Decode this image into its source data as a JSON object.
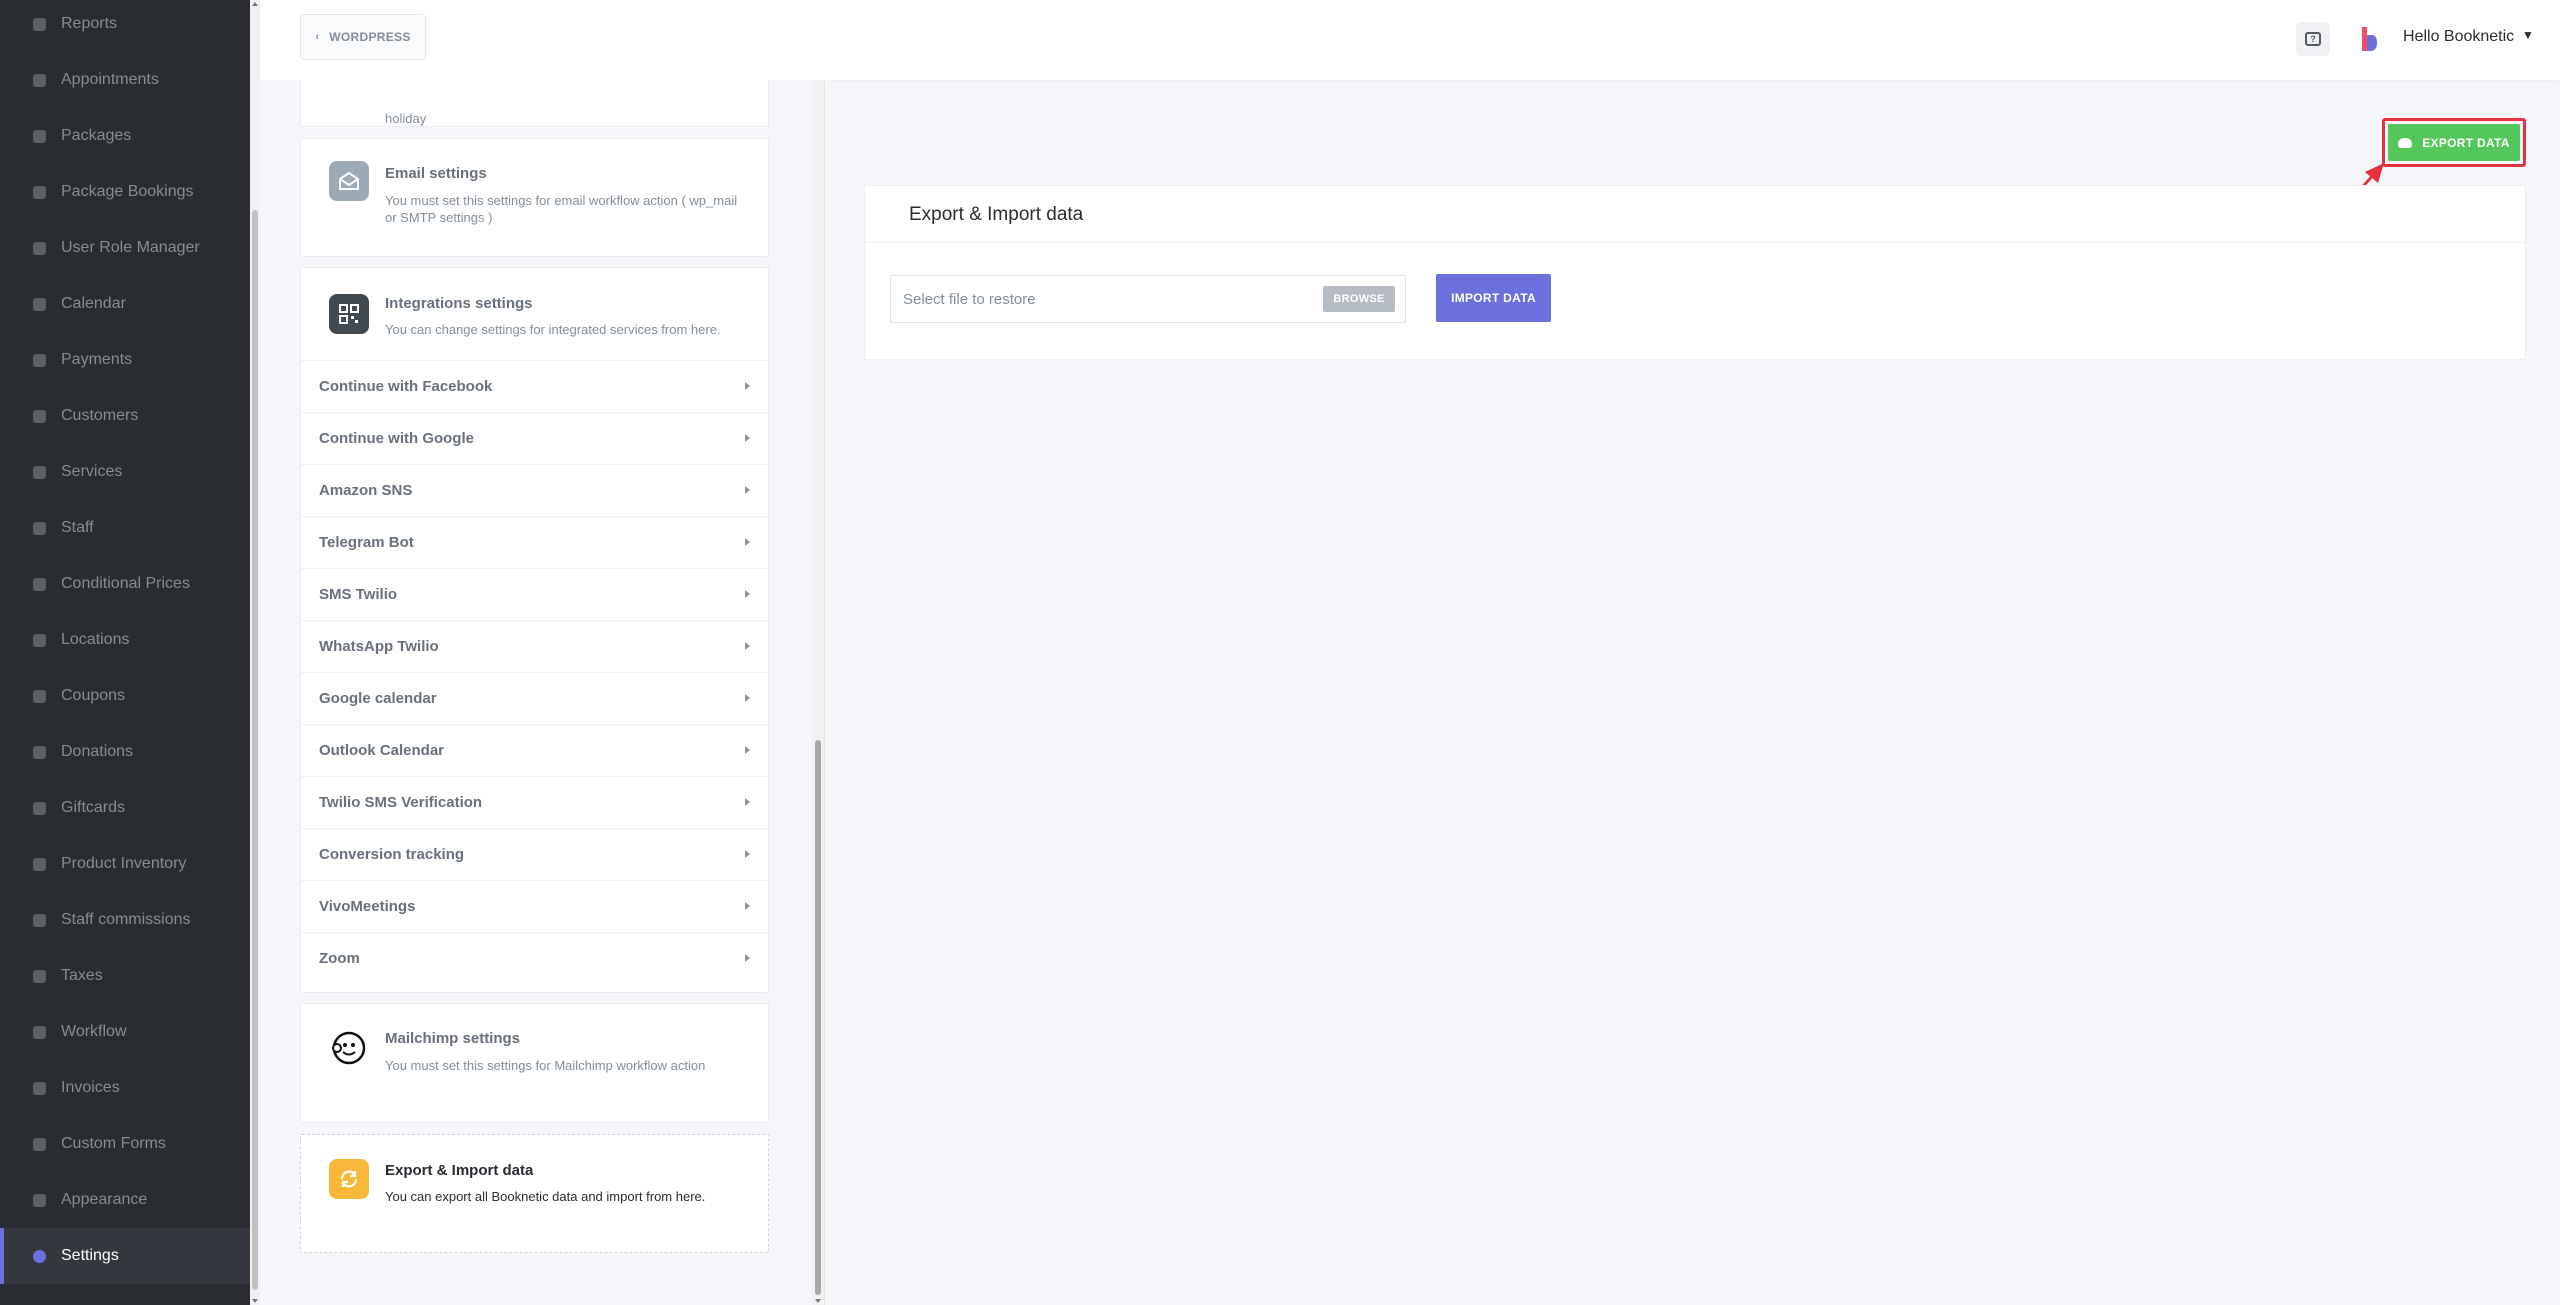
{
  "sidebar": {
    "items": [
      {
        "label": "Reports",
        "icon": "chart-line-icon"
      },
      {
        "label": "Appointments",
        "icon": "clock-icon"
      },
      {
        "label": "Packages",
        "icon": "boxes-icon"
      },
      {
        "label": "Package Bookings",
        "icon": "package-bookings-icon"
      },
      {
        "label": "User Role Manager",
        "icon": "user-plus-icon"
      },
      {
        "label": "Calendar",
        "icon": "calendar-icon"
      },
      {
        "label": "Payments",
        "icon": "wallet-icon"
      },
      {
        "label": "Customers",
        "icon": "users-icon"
      },
      {
        "label": "Services",
        "icon": "list-icon"
      },
      {
        "label": "Staff",
        "icon": "user-icon"
      },
      {
        "label": "Conditional Prices",
        "icon": "text-cursor-icon"
      },
      {
        "label": "Locations",
        "icon": "location-arrow-icon"
      },
      {
        "label": "Coupons",
        "icon": "tags-icon"
      },
      {
        "label": "Donations",
        "icon": "donate-icon"
      },
      {
        "label": "Giftcards",
        "icon": "gift-icon"
      },
      {
        "label": "Product Inventory",
        "icon": "tools-icon"
      },
      {
        "label": "Staff commissions",
        "icon": "handshake-icon"
      },
      {
        "label": "Taxes",
        "icon": "percent-icon"
      },
      {
        "label": "Workflow",
        "icon": "workflow-icon"
      },
      {
        "label": "Invoices",
        "icon": "file-invoice-icon"
      },
      {
        "label": "Custom Forms",
        "icon": "magic-wand-icon"
      },
      {
        "label": "Appearance",
        "icon": "paint-brush-icon"
      },
      {
        "label": "Settings",
        "icon": "gear-icon",
        "active": true
      }
    ]
  },
  "header": {
    "back_label": "WORDPRESS",
    "user_greeting": "Hello Booknetic"
  },
  "settings": {
    "holiday_partial": "holiday",
    "email": {
      "title": "Email settings",
      "desc": "You must set this settings for email workflow action ( wp_mail or SMTP settings )"
    },
    "integrations": {
      "title": "Integrations settings",
      "desc": "You can change settings for integrated services from here.",
      "rows": [
        "Continue with Facebook",
        "Continue with Google",
        "Amazon SNS",
        "Telegram Bot",
        "SMS Twilio",
        "WhatsApp Twilio",
        "Google calendar",
        "Outlook Calendar",
        "Twilio SMS Verification",
        "Conversion tracking",
        "VivoMeetings",
        "Zoom"
      ]
    },
    "mailchimp": {
      "title": "Mailchimp settings",
      "desc": "You must set this settings for Mailchimp workflow action"
    },
    "export_import": {
      "title": "Export & Import data",
      "desc": "You can export all Booknetic data and import from here."
    }
  },
  "main": {
    "export_button": "EXPORT DATA",
    "panel_title": "Export & Import data",
    "file_placeholder": "Select file to restore",
    "browse_button": "BROWSE",
    "import_button": "IMPORT DATA"
  },
  "colors": {
    "sidebar_bg": "#292d32",
    "accent": "#6c70dc",
    "export_green": "#54c75b",
    "highlight_red": "#e5323e"
  }
}
